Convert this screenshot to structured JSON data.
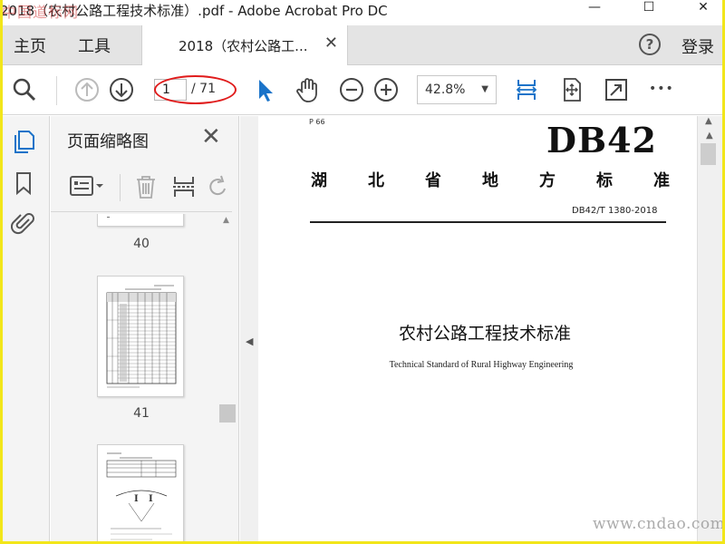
{
  "window": {
    "title": "2018（农村公路工程技术标准）.pdf - Adobe Acrobat Pro DC",
    "watermark_top_left": "中国道标网",
    "minimize": "—",
    "maximize": "☐",
    "close": "✕"
  },
  "tabbar": {
    "home": "主页",
    "tools": "工具",
    "doc_tab_label": "2018（农村公路工...",
    "doc_tab_close": "✕",
    "help": "?",
    "login": "登录"
  },
  "toolbar": {
    "current_page": "1",
    "total_pages": "/ 71",
    "zoom": "42.8%",
    "more": "•••"
  },
  "thumbnail_panel": {
    "title": "页面缩略图",
    "close": "✕",
    "pages": [
      "40",
      "41"
    ]
  },
  "document": {
    "page_tag": "P 66",
    "code": "DB42",
    "province_chars": [
      "湖",
      "北",
      "省",
      "地",
      "方",
      "标",
      "准"
    ],
    "standard_number": "DB42/T 1380-2018",
    "title_cn": "农村公路工程技术标准",
    "title_en": "Technical Standard of Rural Highway Engineering"
  },
  "watermark_bottom_right": "www.cndao.com",
  "colors": {
    "accent_blue": "#1a73c9",
    "annotation_red": "#e01c1c",
    "frame_yellow": "#f2e61a"
  }
}
